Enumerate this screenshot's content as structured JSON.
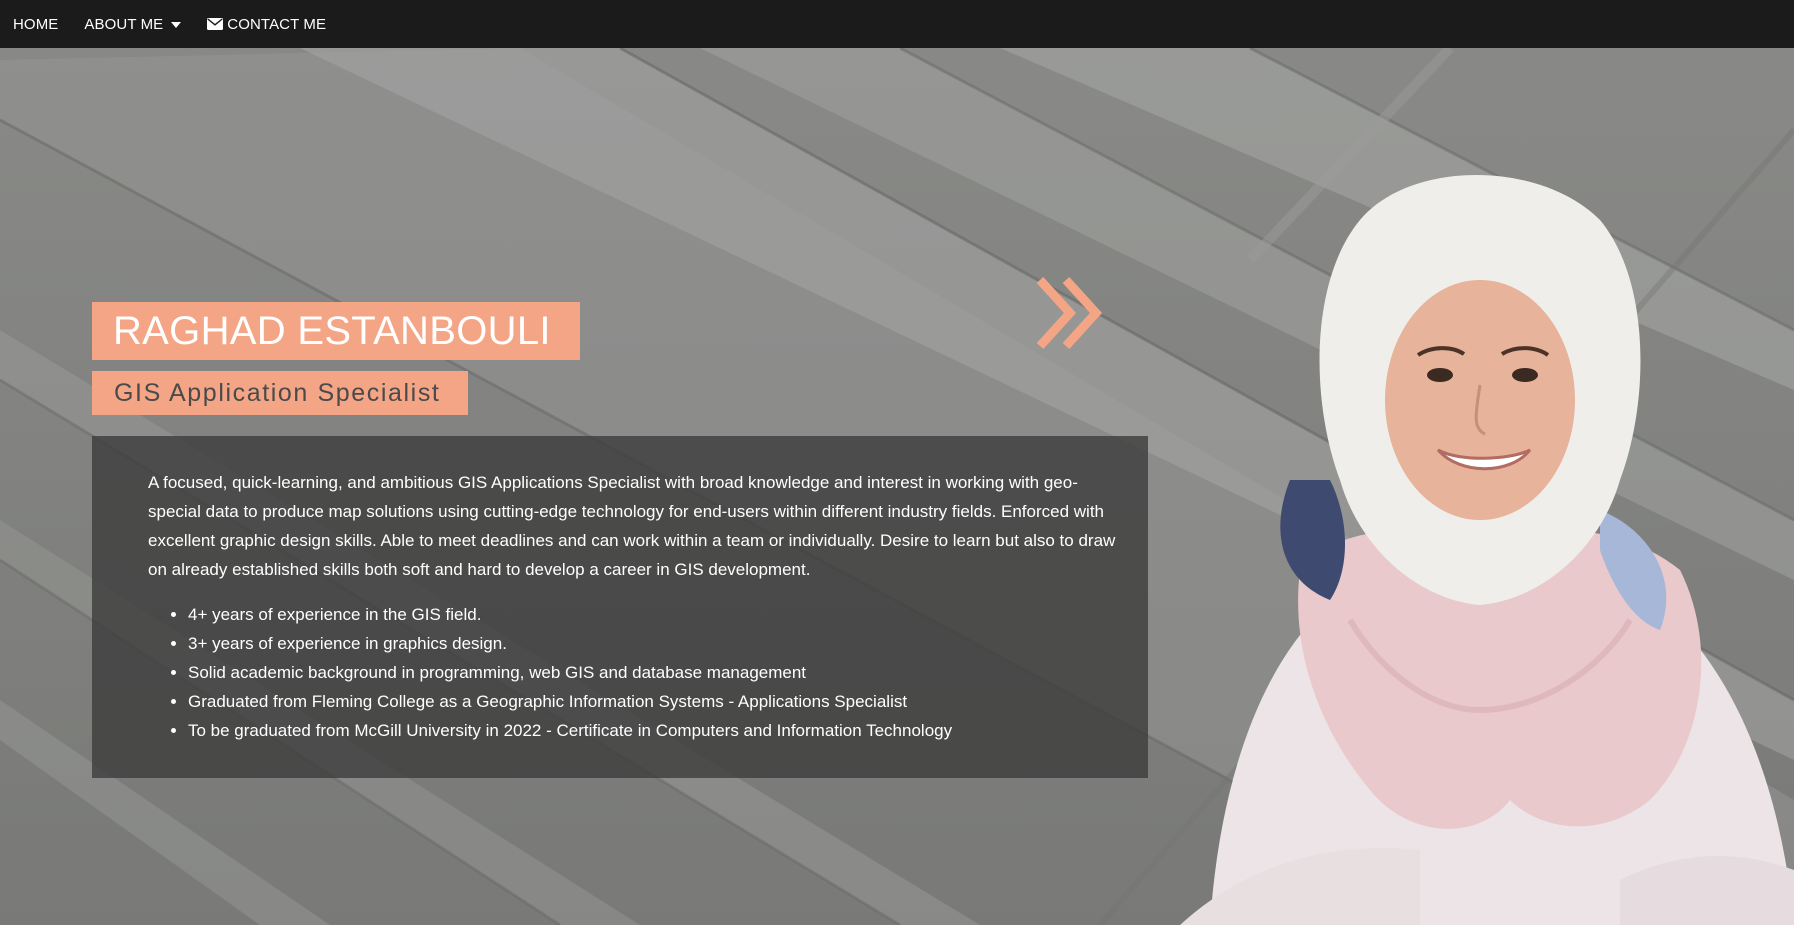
{
  "nav": {
    "home": "HOME",
    "about": "ABOUT ME",
    "contact": "CONTACT ME"
  },
  "hero": {
    "name": "RAGHAD ESTANBOULI",
    "title": "GIS Application Specialist",
    "bio": "A focused, quick-learning, and ambitious GIS Applications Specialist with broad knowledge and interest in working with geo-special data to produce map solutions using cutting-edge technology for end-users within different industry fields. Enforced with excellent graphic design skills. Able to meet deadlines and can work within a team or individually. Desire to learn but also to draw on already established skills both soft and hard to develop a career in GIS development.",
    "highlights": [
      "4+ years of experience in the GIS field.",
      "3+ years of experience in graphics design.",
      "Solid academic background in programming, web GIS and database management",
      "Graduated from Fleming College as a Geographic Information Systems - Applications Specialist",
      "To be graduated from McGill University in 2022 - Certificate in Computers and Information Technology"
    ]
  },
  "theme": {
    "accent": "#f3a585",
    "navbar": "#1b1b1b",
    "panel": "#3c3c3c"
  },
  "icons": {
    "dropdown": "caret-down-icon",
    "contact": "envelope-icon",
    "arrows": "double-chevron-right-icon"
  }
}
